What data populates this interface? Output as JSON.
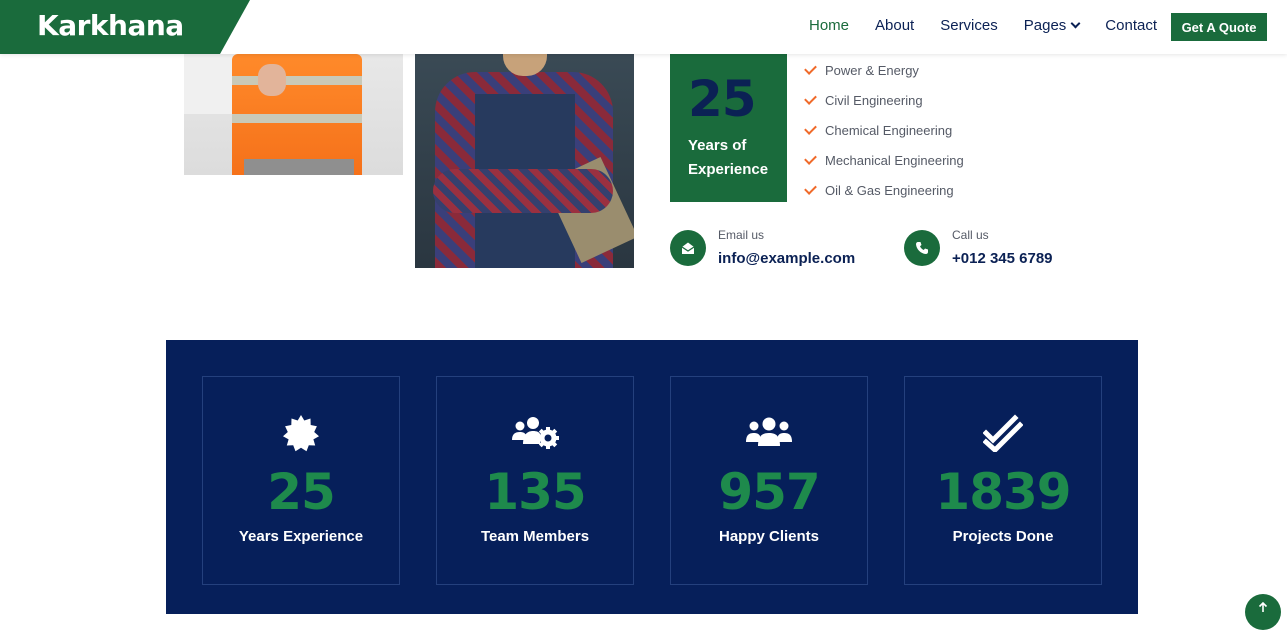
{
  "brand": {
    "name": "Karkhana"
  },
  "nav": {
    "items": [
      {
        "label": "Home"
      },
      {
        "label": "About"
      },
      {
        "label": "Services"
      },
      {
        "label": "Pages"
      },
      {
        "label": "Contact"
      }
    ],
    "cta_label": "Get A Quote"
  },
  "about": {
    "experience_years": "25",
    "experience_label": "Years of Experience",
    "services": [
      "Power & Energy",
      "Civil Engineering",
      "Chemical Engineering",
      "Mechanical Engineering",
      "Oil & Gas Engineering"
    ],
    "email": {
      "label": "Email us",
      "value": "info@example.com"
    },
    "phone": {
      "label": "Call us",
      "value": "+012 345 6789"
    }
  },
  "stats": [
    {
      "value": "25",
      "label": "Years Experience",
      "icon": "award-icon"
    },
    {
      "value": "135",
      "label": "Team Members",
      "icon": "users-cog-icon"
    },
    {
      "value": "957",
      "label": "Happy Clients",
      "icon": "users-icon"
    },
    {
      "value": "1839",
      "label": "Projects Done",
      "icon": "check-double-icon"
    }
  ],
  "colors": {
    "primary_green": "#1a6b3c",
    "navy": "#061f5a",
    "accent_orange": "#f06a2a"
  }
}
